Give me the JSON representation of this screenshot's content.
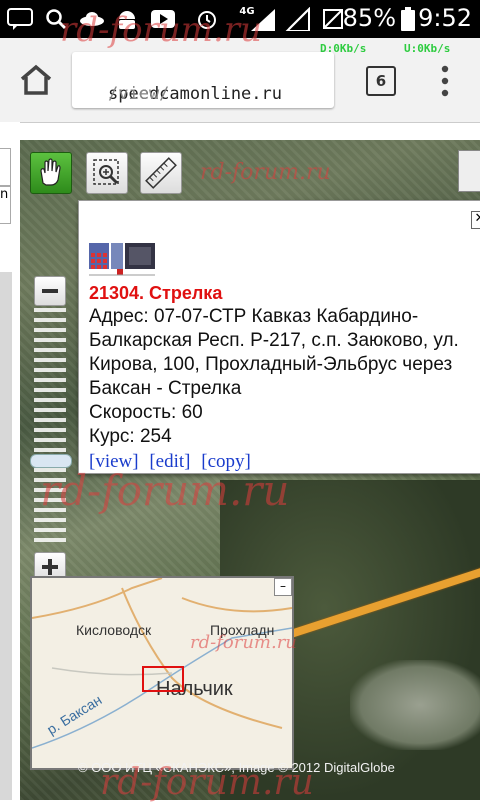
{
  "status_bar": {
    "network": "4G",
    "battery": "85%",
    "time": "9:52"
  },
  "net_speed": {
    "down": "D:0Kb/s",
    "up": "U:0Kb/s"
  },
  "browser": {
    "url_domain": "speedcamonline.ru",
    "url_path": "/view/",
    "tab_count": "6"
  },
  "left_strip": {
    "letter": "n"
  },
  "map": {
    "popup": {
      "title": "21304. Стрелка",
      "address": "Адрес: 07-07-СТР Кавказ Кабардино-Балкарская Респ. Р-217, с.п. Заюково, ул. Кирова, 100, Прохладный-Эльбрус через Баксан - Стрелка",
      "speed": "Скорость: 60",
      "course": "Курс: 254",
      "links": [
        "[view]",
        "[edit]",
        "[copy]"
      ]
    },
    "overview": {
      "labels": [
        "Кисловодск",
        "Прохладн",
        "Нальчик",
        "р. Баксан"
      ]
    },
    "copyright": "© ООО ИТЦ «СКАНЭКС», Image © 2012 DigitalGlobe"
  },
  "watermarks": [
    "rd-forum.ru",
    "rd-forum.ru",
    "rd-forum.ru",
    "rd-forum.ru",
    "rd-forum.ru"
  ],
  "colors": {
    "accent_red": "#e01010",
    "link_blue": "#1a3ccc",
    "tool_active": "#3a9c25",
    "road": "#e8a030"
  }
}
